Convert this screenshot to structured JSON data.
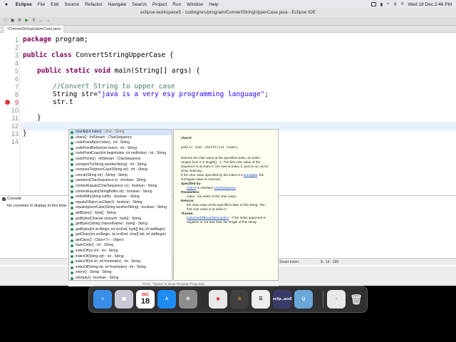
{
  "menubar": {
    "app": "Eclipse",
    "items": [
      "File",
      "Edit",
      "Source",
      "Refactor",
      "Navigate",
      "Search",
      "Project",
      "Run",
      "Window",
      "Help"
    ],
    "clock": "Wed 18 Dec  2:46 PM"
  },
  "window": {
    "title": "eclipse-workspace5 - coding/src/program/ConvertStringUpperCase.java - Eclipse IDE"
  },
  "editor": {
    "tab_label": "*ConvertStringUpperCase.java",
    "line_numbers": [
      "1",
      "2",
      "3",
      "4",
      "5",
      "6",
      "7",
      "8",
      "9",
      "10",
      "11",
      "12",
      "13",
      "14"
    ],
    "lines": {
      "l1": "package program;",
      "l3_kw": "public class",
      "l3_rest": " ConvertStringUpperCase {",
      "l5_kw": "public static void",
      "l5_rest": " main(String[] args) {",
      "l7": "//Convert String to upper case",
      "l8_a": "String str=",
      "l8_b": "\"java is a very esy programming language\"",
      "l8_c": ";",
      "l9": "str.t",
      "l11": "}",
      "l13": "}"
    }
  },
  "autocomplete": {
    "items": [
      {
        "name": "charAt(int index)",
        "ret": ": char - String"
      },
      {
        "name": "chars() : IntStream - CharSequence",
        "ret": ""
      },
      {
        "name": "codePointAt(int index) : int - String",
        "ret": ""
      },
      {
        "name": "codePointBefore(int index) : int - String",
        "ret": ""
      },
      {
        "name": "codePointCount(int beginIndex, int endIndex) : int - String",
        "ret": ""
      },
      {
        "name": "codePoints() : IntStream - CharSequence",
        "ret": ""
      },
      {
        "name": "compareTo(String anotherString) : int - String",
        "ret": ""
      },
      {
        "name": "compareToIgnoreCase(String str) : int - String",
        "ret": ""
      },
      {
        "name": "concat(String str) : String - String",
        "ret": ""
      },
      {
        "name": "contains(CharSequence s) : boolean - String",
        "ret": ""
      },
      {
        "name": "contentEquals(CharSequence cs) : boolean - String",
        "ret": ""
      },
      {
        "name": "contentEquals(StringBuffer sb) : boolean - String",
        "ret": ""
      },
      {
        "name": "endsWith(String suffix) : boolean - String",
        "ret": ""
      },
      {
        "name": "equals(Object anObject) : boolean - String",
        "ret": ""
      },
      {
        "name": "equalsIgnoreCase(String anotherString) : boolean - String",
        "ret": ""
      },
      {
        "name": "getBytes() : byte[] - String",
        "ret": ""
      },
      {
        "name": "getBytes(Charset charset) : byte[] - String",
        "ret": ""
      },
      {
        "name": "getBytes(String charsetName) : byte[] - String",
        "ret": ""
      },
      {
        "name": "getBytes(int srcBegin, int srcEnd, byte[] dst, int dstBegin)",
        "ret": ""
      },
      {
        "name": "getChars(int srcBegin, int srcEnd, char[] dst, int dstBegin)",
        "ret": ""
      },
      {
        "name": "getClass() : Class<?> - Object",
        "ret": ""
      },
      {
        "name": "hashCode() : int - String",
        "ret": ""
      },
      {
        "name": "indexOf(int ch) : int - String",
        "ret": ""
      },
      {
        "name": "indexOf(String str) : int - String",
        "ret": ""
      },
      {
        "name": "indexOf(int ch, int fromIndex) : int - String",
        "ret": ""
      },
      {
        "name": "indexOf(String str, int fromIndex) : int - String",
        "ret": ""
      },
      {
        "name": "intern() : String - String",
        "ret": ""
      },
      {
        "name": "isEmpty() : boolean - String",
        "ret": ""
      }
    ],
    "status_text": "Press '^Space' to show Template Proposals",
    "doc_status": "Press 'Tab' from proposal table or click for focus"
  },
  "javadoc": {
    "heading": "charAt",
    "signature": "public char charAt(int index)",
    "para1": "Returns the char value at the specified index. An index ranges from 0 to length() - 1. The first char value of the sequence is at index 0, the next at index 1, and so on, as for array indexing.",
    "para2a": "If the char value specified by the index is a ",
    "para2_link": "surrogate",
    "para2b": ", the surrogate value is returned.",
    "specified_by": "Specified by:",
    "spec_link": "charAt",
    "spec_in": " in interface ",
    "spec_iface": "CharSequence",
    "params_label": "Parameters:",
    "params_text": "index - the index of the char value.",
    "returns_label": "Returns:",
    "returns_text": "the char value at the specified index of this string. The first char value is at index 0.",
    "throws_label": "Throws:",
    "throws_link": "IndexOutOfBoundsException",
    "throws_text": " - if the index argument is negative or not less than the length of this string."
  },
  "console": {
    "tab_label": "Console",
    "message": "No consoles to display at this time."
  },
  "statusbar": {
    "mode": "Smart Insert",
    "position": "9 : 14 : 199"
  },
  "dock": {
    "calendar_month": "DEC",
    "calendar_day": "18",
    "eclipse_label": "eclip...ace5",
    "colors": {
      "finder": "#3b8ee8",
      "calendar": "#ffffff",
      "chrome": "#e8e8e8"
    }
  }
}
